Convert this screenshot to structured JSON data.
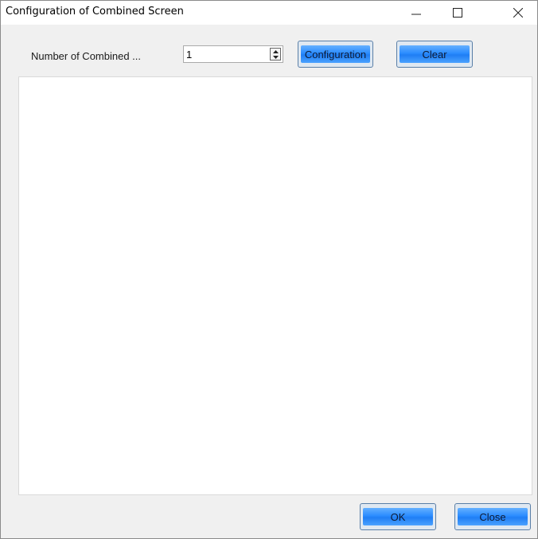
{
  "window": {
    "title": "Configuration of Combined Screen",
    "controls": {
      "minimize_icon": "minimize-icon",
      "maximize_icon": "maximize-icon",
      "close_icon": "close-icon"
    }
  },
  "toolbar": {
    "number_label": "Number of Combined ...",
    "number_value": "1",
    "configuration_label": "Configuration",
    "clear_label": "Clear"
  },
  "footer": {
    "ok_label": "OK",
    "close_label": "Close"
  },
  "colors": {
    "button_blue": "#2b8cff",
    "window_bg": "#f0f0f0",
    "canvas_bg": "#ffffff"
  }
}
